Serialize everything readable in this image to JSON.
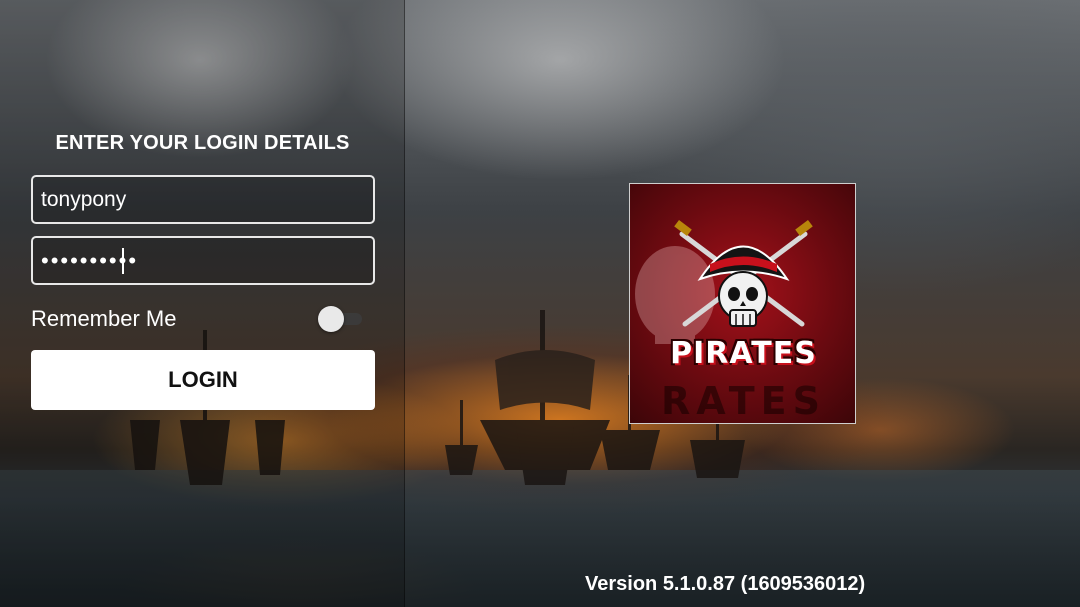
{
  "login": {
    "heading": "ENTER YOUR LOGIN DETAILS",
    "username_value": "tonypony",
    "password_value": "••••••••••",
    "remember_label": "Remember Me",
    "remember_checked": false,
    "button_label": "LOGIN"
  },
  "logo": {
    "text": "PIRATES",
    "echo_text": "RATES",
    "icon": "pirate-skull-logo-icon"
  },
  "footer": {
    "version": "Version 5.1.0.87 (1609536012)"
  },
  "colors": {
    "logo_red": "#a4111a",
    "button_bg": "#ffffff",
    "text": "#ffffff"
  }
}
